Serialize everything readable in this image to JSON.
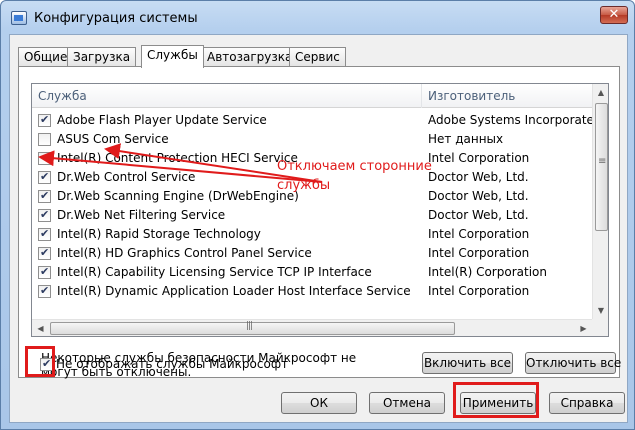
{
  "window": {
    "title": "Конфигурация системы",
    "close_glyph": "✕",
    "icon": "app-config-icon"
  },
  "tabs": [
    {
      "label": "Общие",
      "active": false
    },
    {
      "label": "Загрузка",
      "active": false
    },
    {
      "label": "Службы",
      "active": true
    },
    {
      "label": "Автозагрузка",
      "active": false
    },
    {
      "label": "Сервис",
      "active": false
    }
  ],
  "services": {
    "columns": {
      "name": "Служба",
      "vendor": "Изготовитель"
    },
    "rows": [
      {
        "name": "Adobe Flash Player Update Service",
        "vendor": "Adobe Systems Incorporated",
        "checked": true
      },
      {
        "name": "ASUS Com Service",
        "vendor": "Нет данных",
        "checked": false
      },
      {
        "name": "Intel(R) Content Protection HECI Service",
        "vendor": "Intel Corporation",
        "checked": false
      },
      {
        "name": "Dr.Web Control Service",
        "vendor": "Doctor Web, Ltd.",
        "checked": true
      },
      {
        "name": "Dr.Web Scanning Engine (DrWebEngine)",
        "vendor": "Doctor Web, Ltd.",
        "checked": true
      },
      {
        "name": "Dr.Web Net Filtering Service",
        "vendor": "Doctor Web, Ltd.",
        "checked": true
      },
      {
        "name": "Intel(R) Rapid Storage Technology",
        "vendor": "Intel Corporation",
        "checked": true
      },
      {
        "name": "Intel(R) HD Graphics Control Panel Service",
        "vendor": "Intel Corporation",
        "checked": true
      },
      {
        "name": "Intel(R) Capability Licensing Service TCP IP Interface",
        "vendor": "Intel(R) Corporation",
        "checked": true
      },
      {
        "name": "Intel(R) Dynamic Application Loader Host Interface Service",
        "vendor": "Intel Corporation",
        "checked": true
      }
    ]
  },
  "note": "Некоторые службы безопасности Майкрософт не могут быть отключены.",
  "buttons": {
    "enable_all": "Включить все",
    "disable_all": "Отключить все",
    "ok": "ОК",
    "cancel": "Отмена",
    "apply": "Применить",
    "help": "Справка"
  },
  "hide_ms": {
    "label": "Не отображать службы Майкрософт",
    "checked": true
  },
  "annotation": {
    "text": "Отключаем сторонние службы",
    "color": "#e01b1b"
  }
}
